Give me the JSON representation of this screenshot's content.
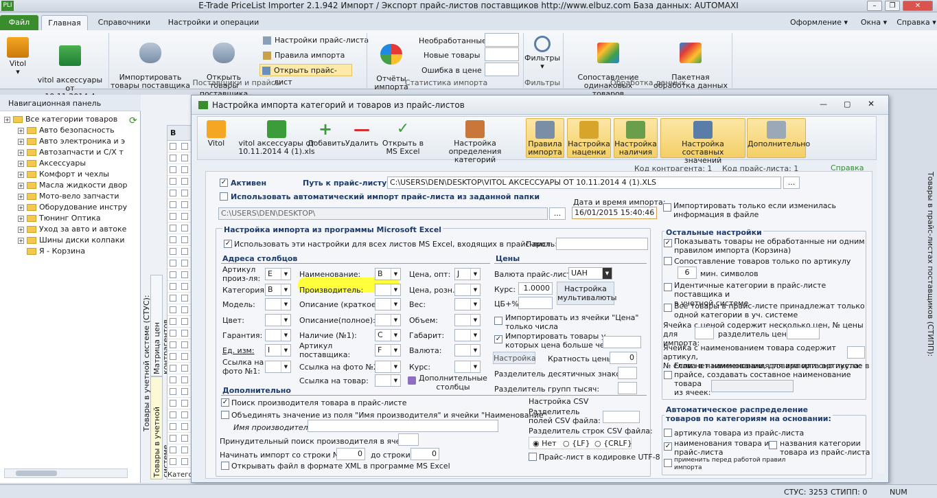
{
  "app": {
    "title": "E-Trade PriceList Importer 2.1.942    Импорт / Экспорт прайс-листов поставщиков    http://www.elbuz.com    База данных: AUTOMAXI",
    "logo": "PLI"
  },
  "tabs": [
    "Файл",
    "Главная",
    "Справочники",
    "Настройки и операции"
  ],
  "right_menu": [
    "Оформление",
    "Окна",
    "Справка"
  ],
  "ribbon": {
    "vitol": "Vitol",
    "file": "vitol аксессуары от\n10.11.2014 4 (1).xls",
    "import_goods": "Импортировать\nтовары поставщика",
    "open_goods": "Открыть товары\nпоставщика",
    "settings_pl": "Настройки прайс-листа",
    "import_rules": "Правила импорта",
    "open_pl": "Открыть прайс-лист",
    "group1": "Поставщики и прайсы",
    "reports": "Отчёты\nимпорта",
    "unprocessed": "Необработанные",
    "new_goods": "Новые товары",
    "price_error": "Ошибка в цене",
    "group2": "Статистика импорта",
    "filters": "Фильтры",
    "group3": "Фильтры",
    "match": "Сопоставление\nодинаковых товаров",
    "batch": "Пакетная\nобработка данных",
    "group4": "Обработка данных"
  },
  "nav": {
    "title": "Навигационная панель",
    "items": [
      "Все категории товаров",
      "Авто безопасность",
      "Авто электроника и э",
      "Автозапчасти и С/Х т",
      "Аксессуары",
      "Комфорт и чехлы",
      "Масла жидкости двор",
      "Мото-вело запчасти",
      "Оборудование инстру",
      "Тюнинг  Оптика",
      "Уход за авто и автоке",
      "Шины диски колпаки",
      "Я - Корзина"
    ]
  },
  "side_tabs": {
    "left1": "Товары в учетной системе (СТУС):",
    "left2": "Матрица цен контрагентов",
    "left3": "Товары в учетной системе",
    "right": "Товары в прайс-листах поставщиков (СТИПП):",
    "grid_cat": "Категор"
  },
  "dialog": {
    "title": "Настройка импорта категорий и товаров из прайс-листов",
    "toolbar": [
      "Vitol",
      "vitol аксессуары от\n10.11.2014 4 (1).xls",
      "Добавить",
      "Удалить",
      "Открыть в\nMS Excel",
      "Настройка определения\nкатегорий",
      "Правила\nимпорта",
      "Настройка\nнаценки",
      "Настройка\nналичия",
      "Настройка составных\nзначений",
      "Дополнительно"
    ],
    "code_contr": "Код контрагента: 1",
    "code_pl": "Код прайс-листа: 1",
    "help": "Справка",
    "active": "Активен",
    "path_label": "Путь к прайс-листу:",
    "path": "C:\\USERS\\DEN\\DESKTOP\\VITOL АКСЕССУАРЫ ОТ 10.11.2014 4 (1).XLS",
    "auto_import": "Использовать автоматический импорт прайс-листа из заданной папки",
    "folder": "C:\\USERS\\DEN\\DESKTOP\\",
    "date_label": "Дата и время импорта:",
    "date": "16/01/2015 15:40:46",
    "only_changed": "Импортировать только если изменилась информация в файле",
    "excel_section": "Настройка импорта из программы Microsoft Excel",
    "use_all_sheets": "Использовать эти настройки для всех листов MS Excel, входящих в прайс-лист",
    "password": "Пароль:",
    "addr": "Адреса столбцов",
    "prices": "Цены",
    "extra": "Дополнительно",
    "col1": [
      {
        "l": "Артикул\nпроиз-ля:",
        "v": "E"
      },
      {
        "l": "Категория:",
        "v": "B"
      },
      {
        "l": "Модель:",
        "v": ""
      },
      {
        "l": "Цвет:",
        "v": ""
      },
      {
        "l": "Гарантия:",
        "v": ""
      },
      {
        "l": "Ед. изм:",
        "v": "I"
      },
      {
        "l": "Ссылка на\nфото №1:",
        "v": ""
      }
    ],
    "col2": [
      {
        "l": "Наименование:",
        "v": "B"
      },
      {
        "l": "Производитель:",
        "v": ""
      },
      {
        "l": "Описание (краткое):",
        "v": ""
      },
      {
        "l": "Описание(полное):",
        "v": ""
      },
      {
        "l": "Наличие (№1):",
        "v": "C"
      },
      {
        "l": "Артикул\nпоставщика:",
        "v": "F"
      },
      {
        "l": "Ссылка на фото №2:",
        "v": ""
      },
      {
        "l": "Ссылка на товар:",
        "v": ""
      }
    ],
    "col3": [
      {
        "l": "Цена, опт:",
        "v": "J"
      },
      {
        "l": "Цена, розн.:",
        "v": ""
      },
      {
        "l": "Вес:",
        "v": ""
      },
      {
        "l": "Объем:",
        "v": ""
      },
      {
        "l": "Габарит:",
        "v": ""
      },
      {
        "l": "Валюта:",
        "v": ""
      },
      {
        "l": "Курс:",
        "v": ""
      }
    ],
    "extra_cols": "Дополнительные\nстолбцы",
    "currency_label": "Валюта прайс-листа:",
    "currency": "UAH",
    "rate_label": "Курс:",
    "rate": "1.0000",
    "cb_label": "ЦБ+%",
    "currency_btn": "Настройка\nмультивалюты",
    "import_price_cell": "Импортировать из ячейки \"Цена\"\nтолько числа",
    "import_price_more": "Импортировать товары у\nкоторых цена больше чем:",
    "setting_btn": "Настройка",
    "multiplicity": "Кратность цены:",
    "multiplicity_v": "0",
    "dec_sep": "Разделитель десятичных знаков:",
    "thou_sep": "Разделитель групп тысяч:",
    "search_maker": "Поиск производителя товара в прайс-листе",
    "combine": "Объединять значение из поля \"Имя производителя\" и ячейки \"Наименование\"",
    "maker_name": "Имя производителя:",
    "forced": "Принудительный поиск производителя в ячейке:",
    "start_row": "Начинать импорт со строки №:",
    "start_v": "0",
    "to_row": "до строки:",
    "to_v": "0",
    "xml": "Открывать файл в формате XML в программе MS Excel",
    "csv_title": "Настройка CSV",
    "csv_field": "Разделитель\nполей CSV файла:",
    "csv_row": "Разделитель строк CSV файла:",
    "csv_opts": [
      "Нет",
      "{LF}",
      "{CRLF}"
    ],
    "utf8": "Прайс-лист в кодировке UTF-8",
    "other": "Остальные настройки",
    "o1": "Показывать товары не обработанные ни одним\nправилом импорта (Корзина)",
    "o2": "Сопоставление товаров только по артикулу",
    "o2v": "6",
    "o2s": "мин. символов",
    "o3": "Идентичные категории в прайс-листе поставщика и\nв учетной системе",
    "o4": "Все товары в прайс-листе принадлежат только\nодной категории в уч. системе",
    "o5": "Ячейка с ценой содержит несколько цен, № цены для\nимпорта:",
    "o5b": "разделитель цены:",
    "o6": "Ячейка с наименованием товара содержит артикул,\n№ слова в наименовании, для импорта артикула:",
    "o7": "Если нет наименования товара или оно пустое в\nпрайсе, создавать составное наименование товара\nиз ячеек:",
    "auto_title": "Автоматическое распределение\nтоваров по категориям на основании:",
    "a1": "артикула товара из прайс-листа",
    "a2": "наименования товара из\nпрайс-листа",
    "a3": "названия  категории\nтовара из прайс-листа",
    "a4": "применить перед работой правил\nимпорта"
  },
  "status": {
    "stus": "СТУС: 3253",
    "stipp": "СТИПП: 0",
    "num": "NUM"
  },
  "colors": {
    "accent": "#3a8d2d",
    "highlight": "#ffff3c",
    "section": "#1d3b6b"
  }
}
